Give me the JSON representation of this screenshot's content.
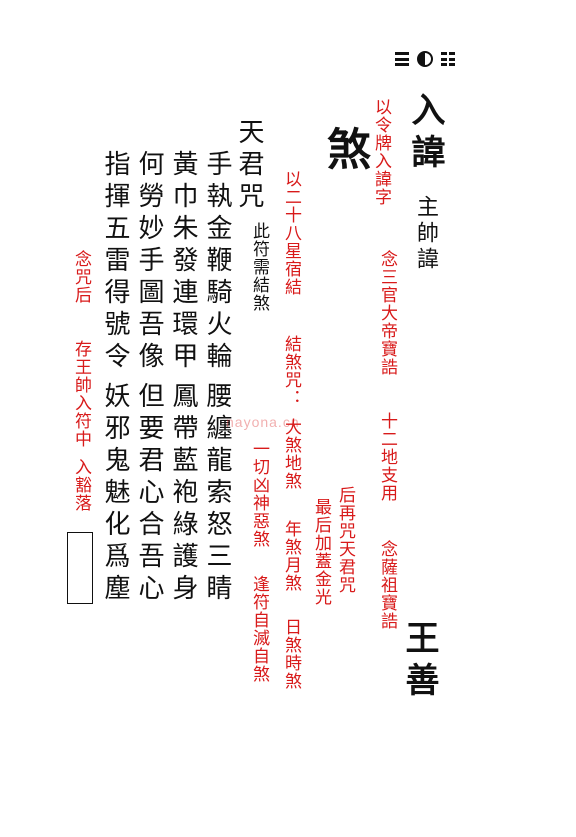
{
  "columns": {
    "c1": "入諱",
    "c2": "主帥諱",
    "c3": "王善",
    "c4": "以令牌入諱字",
    "c5": "念三官大帝寶誥",
    "c6": "十二地支用",
    "c7": "念薩祖寶誥",
    "c8": "煞",
    "c9": "以二十八星宿結",
    "c10": "結煞咒：",
    "c11": "大煞地煞",
    "c12": "年煞月煞",
    "c13": "日煞時煞",
    "c14": "后再咒天君咒",
    "c15": "最后加蓋金光",
    "c16": "一切凶神惡煞",
    "c17": "逢符自滅自煞",
    "c18": "天君咒",
    "c19": "此符需結煞",
    "c20": "手執金鞭騎火輪",
    "c21": "腰纏龍索怒三睛",
    "c22": "黃巾朱發連環甲",
    "c23": "鳳帶藍袍綠護身",
    "c24": "何勞妙手圖吾像",
    "c25": "但要君心合吾心",
    "c26": "指揮五雷得號令",
    "c27": "妖邪鬼魅化爲塵",
    "c28": "念咒后",
    "c29": "存王帥入符中",
    "c30": "入豁落"
  },
  "colors": {
    "black": "#111111",
    "red": "#d81a1a"
  },
  "icons": {
    "trigram": "trigram-taiji-icon",
    "seal": "seal-box"
  }
}
